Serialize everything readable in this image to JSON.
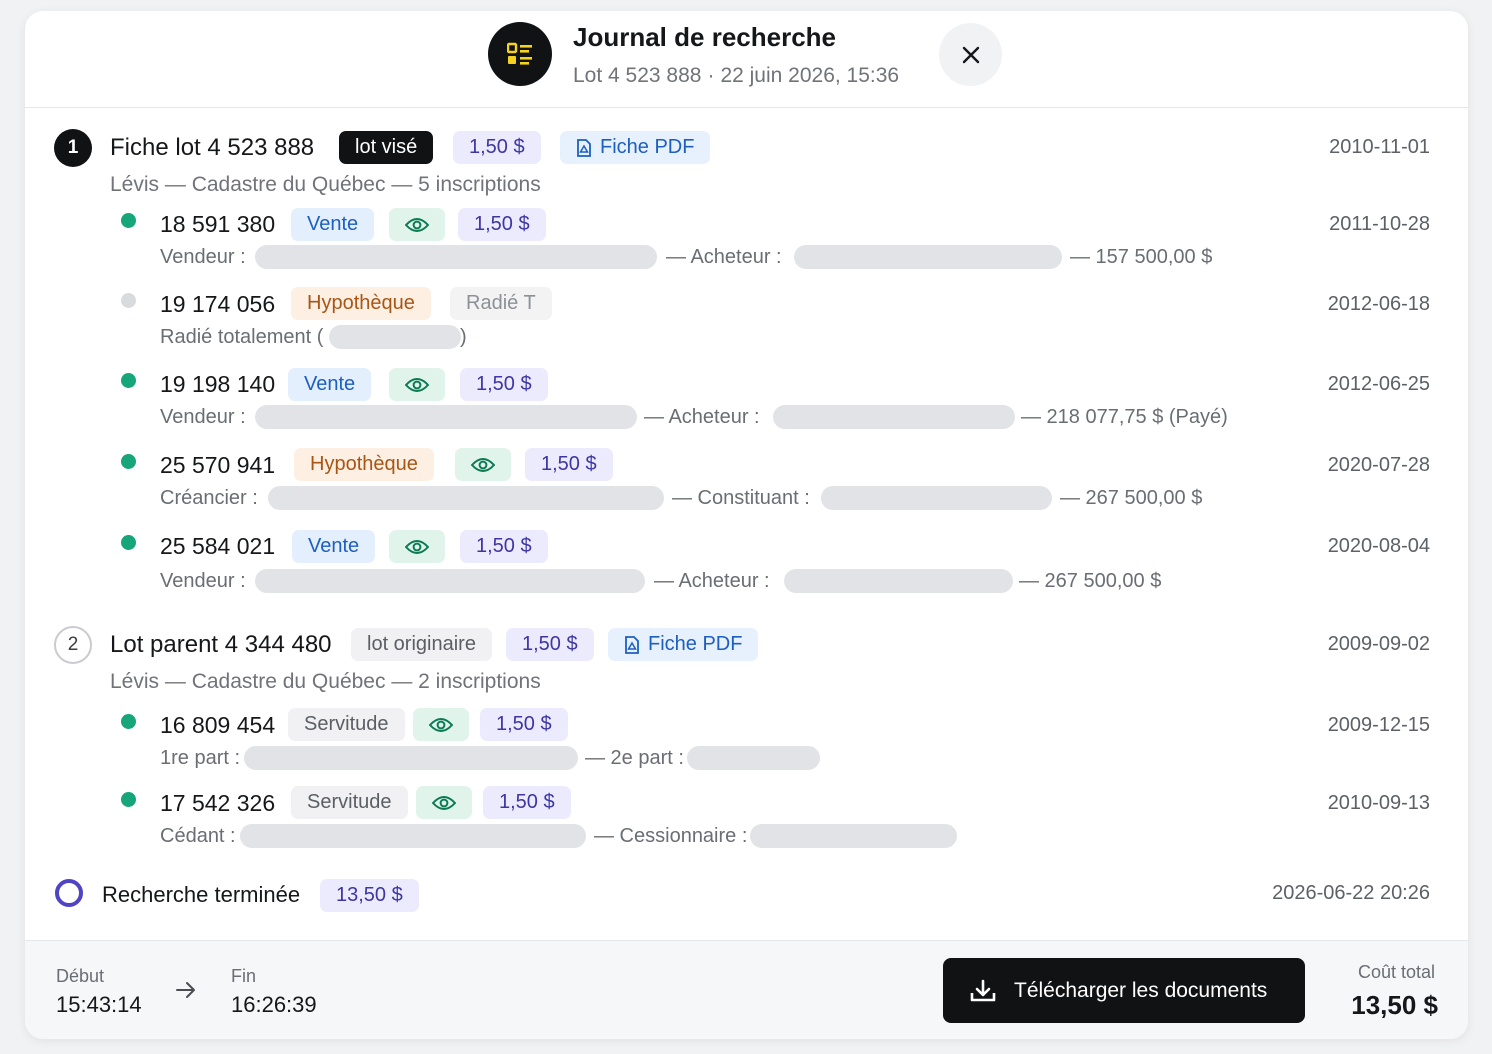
{
  "header": {
    "title": "Journal de recherche",
    "lot": "Lot 4 523 888",
    "separator": "·",
    "datetime": "22 juin 2026, 15:36",
    "logo_icon": "list-icon",
    "close_icon": "close-icon"
  },
  "sections": [
    {
      "number": "1",
      "title": "Fiche lot 4 523 888",
      "role_tag": "lot visé",
      "price": "1,50 $",
      "pdf_label": "Fiche PDF",
      "date": "2010-11-01",
      "subtitle": "Lévis — Cadastre du Québec — 5 inscriptions",
      "entries": [
        {
          "number": "18 591 380",
          "type": "Vente",
          "price": "1,50 $",
          "date": "2011-10-28",
          "status": "active",
          "label_a": "Vendeur :",
          "label_b": "— Acheteur :",
          "amount": "— 157 500,00 $"
        },
        {
          "number": "19 174 056",
          "type": "Hypothèque",
          "status_tag": "Radié T",
          "date": "2012-06-18",
          "status": "radie",
          "label_a": "Radié totalement (",
          "label_close": ")"
        },
        {
          "number": "19 198 140",
          "type": "Vente",
          "price": "1,50 $",
          "date": "2012-06-25",
          "status": "active",
          "label_a": "Vendeur :",
          "label_b": "— Acheteur :",
          "amount": "— 218 077,75 $ (Payé)"
        },
        {
          "number": "25 570 941",
          "type": "Hypothèque",
          "price": "1,50 $",
          "date": "2020-07-28",
          "status": "active",
          "label_a": "Créancier :",
          "label_b": "— Constituant :",
          "amount": "— 267 500,00 $"
        },
        {
          "number": "25 584 021",
          "type": "Vente",
          "price": "1,50 $",
          "date": "2020-08-04",
          "status": "active",
          "label_a": "Vendeur :",
          "label_b": "— Acheteur :",
          "amount": "— 267 500,00 $"
        }
      ]
    },
    {
      "number": "2",
      "title": "Lot parent 4 344 480",
      "role_tag": "lot originaire",
      "price": "1,50 $",
      "pdf_label": "Fiche PDF",
      "date": "2009-09-02",
      "subtitle": "Lévis — Cadastre du Québec — 2 inscriptions",
      "entries": [
        {
          "number": "16 809 454",
          "type": "Servitude",
          "price": "1,50 $",
          "date": "2009-12-15",
          "status": "active",
          "label_a": "1re part :",
          "label_b": "— 2e part :"
        },
        {
          "number": "17 542 326",
          "type": "Servitude",
          "price": "1,50 $",
          "date": "2010-09-13",
          "status": "active",
          "label_a": "Cédant :",
          "label_b": "— Cessionnaire :"
        }
      ]
    }
  ],
  "finished": {
    "label": "Recherche terminée",
    "price": "13,50 $",
    "datetime": "2026-06-22 20:26"
  },
  "footer": {
    "start_label": "Début",
    "start_time": "15:43:14",
    "end_label": "Fin",
    "end_time": "16:26:39",
    "download_label": "Télécharger les documents",
    "total_label": "Coût total",
    "total_value": "13,50 $"
  },
  "colors": {
    "accent": "#4f45c4",
    "active_dot": "#17a57a",
    "logo_icon": "#f4d21f"
  }
}
